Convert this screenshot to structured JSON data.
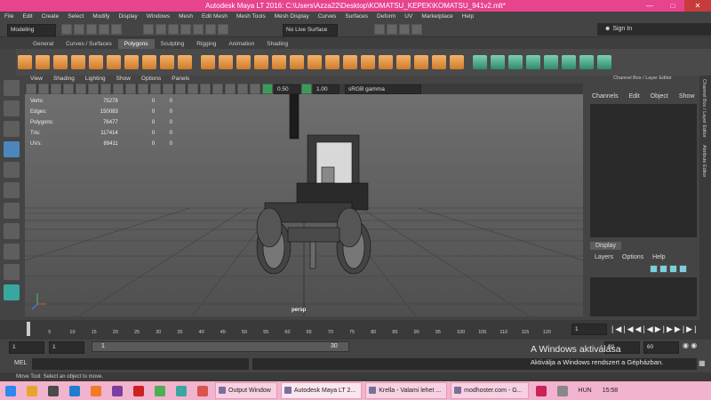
{
  "window": {
    "title": "Autodesk Maya LT 2016: C:\\Users\\Azza22\\Desktop\\KOMATSU_KEPEK\\KOMATSU_941v2.mlt*"
  },
  "menubar": [
    "File",
    "Edit",
    "Create",
    "Select",
    "Modify",
    "Display",
    "Windows",
    "Mesh",
    "Edit Mesh",
    "Mesh Tools",
    "Mesh Display",
    "Curves",
    "Surfaces",
    "Deform",
    "UV",
    "Marketplace",
    "Help"
  ],
  "status": {
    "mode": "Modeling",
    "live_surface": "No Live Surface",
    "signin": "Sign In"
  },
  "shelf_tabs": [
    "General",
    "Curves / Surfaces",
    "Polygons",
    "Sculpting",
    "Rigging",
    "Animation",
    "Shading"
  ],
  "shelf_active": "Polygons",
  "viewport": {
    "menu": [
      "View",
      "Shading",
      "Lighting",
      "Show",
      "Options",
      "Panels"
    ],
    "exposure": "0.50",
    "gamma": "1.00",
    "colorspace": "sRGB gamma",
    "camera_label": "persp",
    "hud": [
      {
        "label": "Verts:",
        "a": "75278",
        "b": "0",
        "c": "0"
      },
      {
        "label": "Edges:",
        "a": "150083",
        "b": "0",
        "c": "0"
      },
      {
        "label": "Polygons:",
        "a": "76477",
        "b": "0",
        "c": "0"
      },
      {
        "label": "Tris:",
        "a": "117414",
        "b": "0",
        "c": "0"
      },
      {
        "label": "UVs:",
        "a": "89411",
        "b": "0",
        "c": "0"
      }
    ]
  },
  "channelbox": {
    "title": "Channel Box / Layer Editor",
    "menu": [
      "Channels",
      "Edit",
      "Object",
      "Show"
    ]
  },
  "layer": {
    "tab": "Display",
    "menu": [
      "Layers",
      "Options",
      "Help"
    ]
  },
  "side_tabs": [
    "Channel Box / Layer Editor",
    "Attribute Editor"
  ],
  "timeline": {
    "ticks": [
      "1",
      "5",
      "10",
      "15",
      "20",
      "25",
      "30",
      "35",
      "40",
      "45",
      "50",
      "55",
      "60",
      "65",
      "70",
      "75",
      "80",
      "85",
      "90",
      "95",
      "100",
      "105",
      "110",
      "115",
      "120"
    ],
    "current": "1"
  },
  "range": {
    "start": "1",
    "start2": "1",
    "slider_start": "1",
    "slider_end": "30",
    "end": "30",
    "end2": "60"
  },
  "mel": {
    "label": "MEL"
  },
  "help_line": "Move Tool: Select an object to move.",
  "watermark": {
    "line1": "A Windows aktiválása",
    "line2": "Aktiválja a Windows rendszert a Gépházban."
  },
  "taskbar": {
    "buttons": [
      "Output Window",
      "Autodesk Maya LT 2...",
      "Krella - Valami lehet ...",
      "modhoster.com - G..."
    ],
    "lang": "HUN",
    "time": "15:58"
  }
}
